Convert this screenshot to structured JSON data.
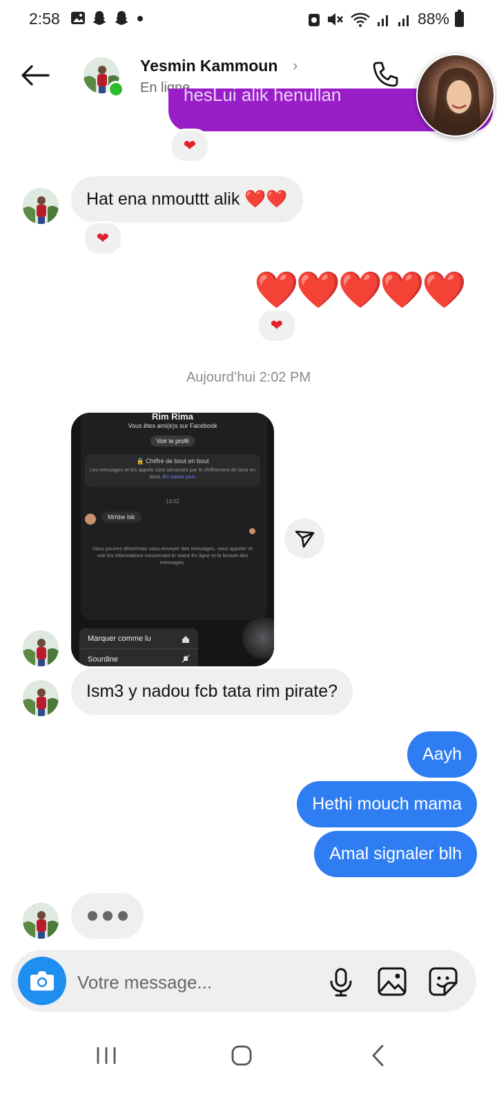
{
  "status_bar": {
    "time": "2:58",
    "battery": "88%"
  },
  "header": {
    "name": "Yesmin Kammoun",
    "chevron": "›",
    "status": "En ligne"
  },
  "messages": {
    "top_partial": "hesLui alik henullan",
    "reaction_heart": "❤",
    "m1": "Hat ena nmouttt alik ❤️❤️",
    "hearts_big": "❤️❤️❤️❤️❤️",
    "timestamp": "Aujourd’hui 2:02 PM",
    "m_question": "Ism3 y nadou fcb tata rim pirate?",
    "out1": "Aayh",
    "out2": "Hethi mouch mama",
    "out3": "Amal signaler blh"
  },
  "shared_screenshot": {
    "name": "Rim Rima",
    "subtitle": "Vous êtes ami(e)s sur Facebook",
    "profile_button": "Voir le profil",
    "encrypt_title": "🔒 Chiffré de bout en bout",
    "encrypt_body": "Les messages et les appels sont sécurisés par le chiffrement de bout en bout.",
    "learn_more": "En savoir plus",
    "time": "14:02",
    "msg": "Mrhbe bik",
    "info": "Vous pouvez désormais vous envoyer des messages, vous appeler et voir les informations concernant le statut En ligne et la lecture des messages.",
    "menu_mark": "Marquer comme lu",
    "menu_mute": "Sourdine"
  },
  "composer": {
    "placeholder": "Votre message..."
  },
  "colors": {
    "outgoing": "#2f7df2",
    "incoming": "#efefef",
    "camera": "#1e8ff0",
    "online": "#2dbb30",
    "heart": "#e0202a"
  }
}
